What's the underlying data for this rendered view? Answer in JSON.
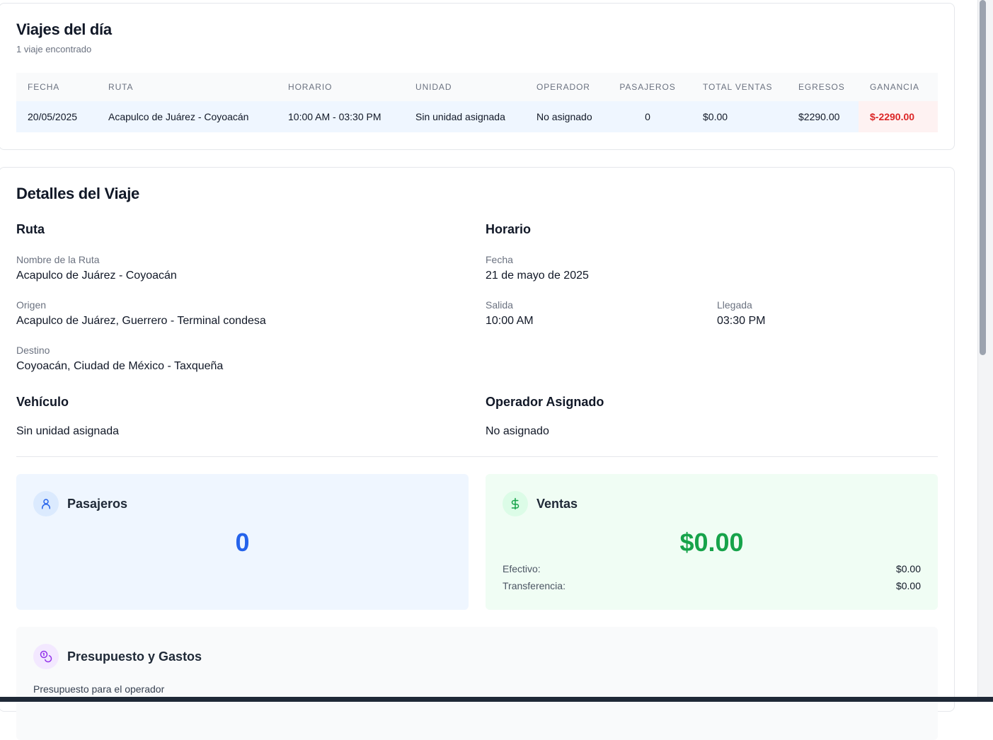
{
  "trips": {
    "title": "Viajes del día",
    "count_text": "1 viaje encontrado",
    "headers": [
      "FECHA",
      "RUTA",
      "HORARIO",
      "UNIDAD",
      "OPERADOR",
      "PASAJEROS",
      "TOTAL VENTAS",
      "EGRESOS",
      "GANANCIA"
    ],
    "rows": [
      {
        "fecha": "20/05/2025",
        "ruta": "Acapulco de Juárez - Coyoacán",
        "horario": "10:00 AM - 03:30 PM",
        "unidad": "Sin unidad asignada",
        "operador": "No asignado",
        "pasajeros": "0",
        "total_ventas": "$0.00",
        "egresos": "$2290.00",
        "ganancia": "$-2290.00"
      }
    ],
    "colors": {
      "row_bg": "#eff6ff",
      "loss_bg": "#fef2f2",
      "loss_text": "#dc2626"
    }
  },
  "details": {
    "title": "Detalles del Viaje",
    "ruta": {
      "heading": "Ruta",
      "name_label": "Nombre de la Ruta",
      "name_value": "Acapulco de Juárez - Coyoacán",
      "origin_label": "Origen",
      "origin_value": "Acapulco de Juárez, Guerrero - Terminal condesa",
      "dest_label": "Destino",
      "dest_value": "Coyoacán, Ciudad de México - Taxqueña"
    },
    "horario": {
      "heading": "Horario",
      "date_label": "Fecha",
      "date_value": "21 de mayo de 2025",
      "dep_label": "Salida",
      "dep_value": "10:00 AM",
      "arr_label": "Llegada",
      "arr_value": "03:30 PM"
    },
    "vehiculo": {
      "heading": "Vehículo",
      "value": "Sin unidad asignada"
    },
    "operador": {
      "heading": "Operador Asignado",
      "value": "No asignado"
    }
  },
  "stats": {
    "pasajeros": {
      "title": "Pasajeros",
      "value": "0",
      "icon": "user-icon",
      "color": "#2563eb"
    },
    "ventas": {
      "title": "Ventas",
      "value": "$0.00",
      "icon": "dollar-icon",
      "color": "#16a34a",
      "efectivo_label": "Efectivo:",
      "efectivo_value": "$0.00",
      "transfer_label": "Transferencia:",
      "transfer_value": "$0.00"
    },
    "presupuesto": {
      "title": "Presupuesto y Gastos",
      "icon": "coins-icon",
      "color": "#9333ea",
      "operator_budget_label": "Presupuesto para el operador"
    }
  }
}
